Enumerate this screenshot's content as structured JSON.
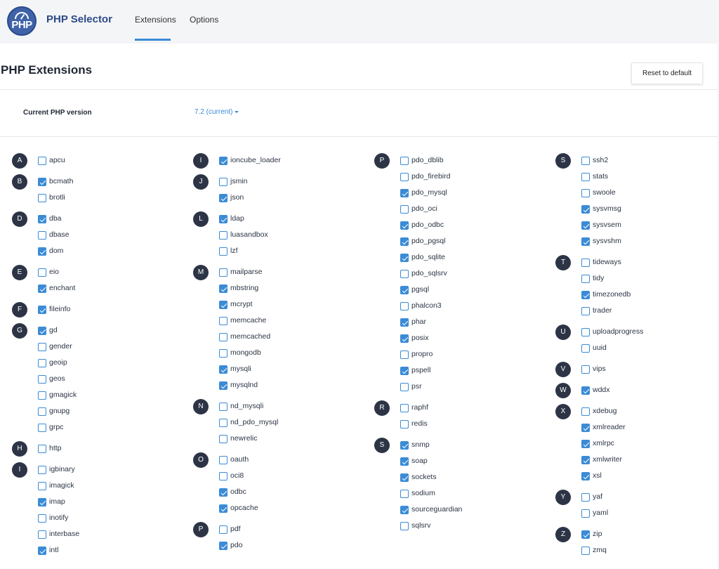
{
  "app": {
    "logo_text": "PHP",
    "title": "PHP Selector"
  },
  "tabs": [
    {
      "label": "Extensions",
      "active": true
    },
    {
      "label": "Options",
      "active": false
    }
  ],
  "page": {
    "title": "PHP Extensions",
    "reset_label": "Reset to default",
    "version_label": "Current PHP version",
    "version_value": "7.2 (current)"
  },
  "colors": {
    "accent": "#3b8bd6",
    "badge": "#2c3446",
    "brand": "#2b4a86"
  },
  "columns": [
    [
      {
        "letter": "A",
        "items": [
          {
            "name": "apcu",
            "checked": false
          }
        ]
      },
      {
        "letter": "B",
        "items": [
          {
            "name": "bcmath",
            "checked": true
          },
          {
            "name": "brotli",
            "checked": false
          }
        ]
      },
      {
        "letter": "D",
        "items": [
          {
            "name": "dba",
            "checked": true
          },
          {
            "name": "dbase",
            "checked": false
          },
          {
            "name": "dom",
            "checked": true
          }
        ]
      },
      {
        "letter": "E",
        "items": [
          {
            "name": "eio",
            "checked": false
          },
          {
            "name": "enchant",
            "checked": true
          }
        ]
      },
      {
        "letter": "F",
        "items": [
          {
            "name": "fileinfo",
            "checked": true
          }
        ]
      },
      {
        "letter": "G",
        "items": [
          {
            "name": "gd",
            "checked": true
          },
          {
            "name": "gender",
            "checked": false
          },
          {
            "name": "geoip",
            "checked": false
          },
          {
            "name": "geos",
            "checked": false
          },
          {
            "name": "gmagick",
            "checked": false
          },
          {
            "name": "gnupg",
            "checked": false
          },
          {
            "name": "grpc",
            "checked": false
          }
        ]
      },
      {
        "letter": "H",
        "items": [
          {
            "name": "http",
            "checked": false
          }
        ]
      },
      {
        "letter": "I",
        "items": [
          {
            "name": "igbinary",
            "checked": false
          },
          {
            "name": "imagick",
            "checked": false
          },
          {
            "name": "imap",
            "checked": true
          },
          {
            "name": "inotify",
            "checked": false
          },
          {
            "name": "interbase",
            "checked": false
          },
          {
            "name": "intl",
            "checked": true
          }
        ]
      }
    ],
    [
      {
        "letter": "I",
        "items": [
          {
            "name": "ioncube_loader",
            "checked": true
          }
        ]
      },
      {
        "letter": "J",
        "items": [
          {
            "name": "jsmin",
            "checked": false
          },
          {
            "name": "json",
            "checked": true
          }
        ]
      },
      {
        "letter": "L",
        "items": [
          {
            "name": "ldap",
            "checked": true
          },
          {
            "name": "luasandbox",
            "checked": false
          },
          {
            "name": "lzf",
            "checked": false
          }
        ]
      },
      {
        "letter": "M",
        "items": [
          {
            "name": "mailparse",
            "checked": false
          },
          {
            "name": "mbstring",
            "checked": true
          },
          {
            "name": "mcrypt",
            "checked": true
          },
          {
            "name": "memcache",
            "checked": false
          },
          {
            "name": "memcached",
            "checked": false
          },
          {
            "name": "mongodb",
            "checked": false
          },
          {
            "name": "mysqli",
            "checked": true
          },
          {
            "name": "mysqlnd",
            "checked": true
          }
        ]
      },
      {
        "letter": "N",
        "items": [
          {
            "name": "nd_mysqli",
            "checked": false
          },
          {
            "name": "nd_pdo_mysql",
            "checked": false
          },
          {
            "name": "newrelic",
            "checked": false
          }
        ]
      },
      {
        "letter": "O",
        "items": [
          {
            "name": "oauth",
            "checked": false
          },
          {
            "name": "oci8",
            "checked": false
          },
          {
            "name": "odbc",
            "checked": true
          },
          {
            "name": "opcache",
            "checked": true
          }
        ]
      },
      {
        "letter": "P",
        "items": [
          {
            "name": "pdf",
            "checked": false
          },
          {
            "name": "pdo",
            "checked": true
          }
        ]
      }
    ],
    [
      {
        "letter": "P",
        "items": [
          {
            "name": "pdo_dblib",
            "checked": false
          },
          {
            "name": "pdo_firebird",
            "checked": false
          },
          {
            "name": "pdo_mysql",
            "checked": true
          },
          {
            "name": "pdo_oci",
            "checked": false
          },
          {
            "name": "pdo_odbc",
            "checked": true
          },
          {
            "name": "pdo_pgsql",
            "checked": true
          },
          {
            "name": "pdo_sqlite",
            "checked": true
          },
          {
            "name": "pdo_sqlsrv",
            "checked": false
          },
          {
            "name": "pgsql",
            "checked": true
          },
          {
            "name": "phalcon3",
            "checked": false
          },
          {
            "name": "phar",
            "checked": true
          },
          {
            "name": "posix",
            "checked": true
          },
          {
            "name": "propro",
            "checked": false
          },
          {
            "name": "pspell",
            "checked": true
          },
          {
            "name": "psr",
            "checked": false
          }
        ]
      },
      {
        "letter": "R",
        "items": [
          {
            "name": "raphf",
            "checked": false
          },
          {
            "name": "redis",
            "checked": false
          }
        ]
      },
      {
        "letter": "S",
        "items": [
          {
            "name": "snmp",
            "checked": true
          },
          {
            "name": "soap",
            "checked": true
          },
          {
            "name": "sockets",
            "checked": true
          },
          {
            "name": "sodium",
            "checked": false
          },
          {
            "name": "sourceguardian",
            "checked": true
          },
          {
            "name": "sqlsrv",
            "checked": false
          }
        ]
      }
    ],
    [
      {
        "letter": "S",
        "items": [
          {
            "name": "ssh2",
            "checked": false
          },
          {
            "name": "stats",
            "checked": false
          },
          {
            "name": "swoole",
            "checked": false
          },
          {
            "name": "sysvmsg",
            "checked": true
          },
          {
            "name": "sysvsem",
            "checked": true
          },
          {
            "name": "sysvshm",
            "checked": true
          }
        ]
      },
      {
        "letter": "T",
        "items": [
          {
            "name": "tideways",
            "checked": false
          },
          {
            "name": "tidy",
            "checked": false
          },
          {
            "name": "timezonedb",
            "checked": true
          },
          {
            "name": "trader",
            "checked": false
          }
        ]
      },
      {
        "letter": "U",
        "items": [
          {
            "name": "uploadprogress",
            "checked": false
          },
          {
            "name": "uuid",
            "checked": false
          }
        ]
      },
      {
        "letter": "V",
        "items": [
          {
            "name": "vips",
            "checked": false
          }
        ]
      },
      {
        "letter": "W",
        "items": [
          {
            "name": "wddx",
            "checked": true
          }
        ]
      },
      {
        "letter": "X",
        "items": [
          {
            "name": "xdebug",
            "checked": false
          },
          {
            "name": "xmlreader",
            "checked": true
          },
          {
            "name": "xmlrpc",
            "checked": true
          },
          {
            "name": "xmlwriter",
            "checked": true
          },
          {
            "name": "xsl",
            "checked": true
          }
        ]
      },
      {
        "letter": "Y",
        "items": [
          {
            "name": "yaf",
            "checked": false
          },
          {
            "name": "yaml",
            "checked": false
          }
        ]
      },
      {
        "letter": "Z",
        "items": [
          {
            "name": "zip",
            "checked": true
          },
          {
            "name": "zmq",
            "checked": false
          }
        ]
      }
    ]
  ]
}
